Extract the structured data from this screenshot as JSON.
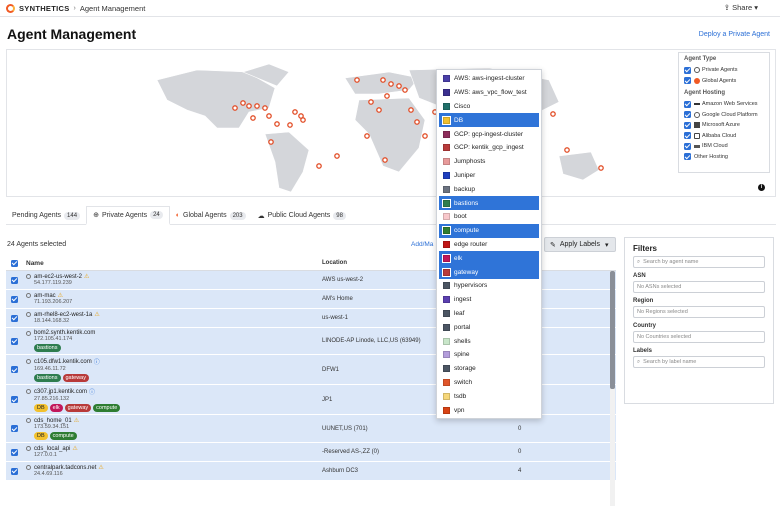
{
  "header": {
    "brand": "SYNTHETICS",
    "breadcrumb": "Agent Management",
    "share_label": "Share"
  },
  "page": {
    "title": "Agent Management",
    "deploy_link": "Deploy a Private Agent"
  },
  "legend": {
    "agent_type_title": "Agent Type",
    "agent_types": [
      {
        "label": "Private Agents",
        "icon": "globe-outline-icon"
      },
      {
        "label": "Global Agents",
        "icon": "kentik-logo-icon"
      }
    ],
    "hosting_title": "Agent Hosting",
    "hosting": [
      {
        "label": "Amazon Web Services",
        "icon": "aws-icon"
      },
      {
        "label": "Google Cloud Platform",
        "icon": "gcp-icon"
      },
      {
        "label": "Microsoft Azure",
        "icon": "azure-icon"
      },
      {
        "label": "Alibaba Cloud",
        "icon": "alibaba-icon"
      },
      {
        "label": "IBM Cloud",
        "icon": "ibm-icon"
      },
      {
        "label": "Other Hosting",
        "icon": ""
      }
    ]
  },
  "tabs": [
    {
      "label": "Pending Agents",
      "count": "144"
    },
    {
      "label": "Private Agents",
      "count": "24"
    },
    {
      "label": "Global Agents",
      "count": "203"
    },
    {
      "label": "Public Cloud Agents",
      "count": "98"
    }
  ],
  "toolbar": {
    "selected_count": "24 Agents selected",
    "add_manage": "Add/Ma",
    "apply_labels": "Apply Labels"
  },
  "table": {
    "headers": {
      "name": "Name",
      "location": "Location"
    },
    "rows": [
      {
        "name": "am-ec2-us-west-2",
        "ip": "54.177.119.239",
        "location": "AWS us-west-2",
        "version": "",
        "warn": true,
        "info": false,
        "tags": []
      },
      {
        "name": "am-mac",
        "ip": "71.193.206.207",
        "location": "AM's Home",
        "version": "",
        "warn": true,
        "info": false,
        "tags": []
      },
      {
        "name": "am-rhel8-ec2-west-1a",
        "ip": "18.144.168.32",
        "location": "us-west-1",
        "version": "",
        "warn": true,
        "info": false,
        "tags": []
      },
      {
        "name": "bom2.synth.kentik.com",
        "ip": "172.105.41.174",
        "location": "LINODE-AP Linode, LLC,US (63949)",
        "version": "",
        "warn": false,
        "info": false,
        "tags": [
          "bastions"
        ]
      },
      {
        "name": "c105.dfw1.kentik.com",
        "ip": "169.46.11.72",
        "location": "DFW1",
        "version": "",
        "warn": false,
        "info": true,
        "tags": [
          "bastions",
          "gateway"
        ]
      },
      {
        "name": "c307.jp1.kentik.com",
        "ip": "27.85.216.132",
        "location": "JP1",
        "version": "",
        "warn": false,
        "info": true,
        "tags": [
          "DB",
          "elk",
          "gateway",
          "compute"
        ]
      },
      {
        "name": "cds_home_01",
        "ip": "173.59.34.151",
        "location": "UUNET,US (701)",
        "version": "0",
        "warn": true,
        "info": false,
        "tags": [
          "DB",
          "compute"
        ]
      },
      {
        "name": "cds_local_api",
        "ip": "127.0.0.1",
        "location": "-Reserved AS-,ZZ (0)",
        "version": "0",
        "warn": true,
        "info": false,
        "tags": []
      },
      {
        "name": "centralpark.tadcons.net",
        "ip": "24.4.69.116",
        "location": "Ashburn DC3",
        "version": "4",
        "warn": true,
        "info": false,
        "tags": []
      }
    ]
  },
  "tag_colors": {
    "bastions": "#2e7d4f",
    "gateway": "#b83a3a",
    "DB": "#f2c12e",
    "elk": "#c2185b",
    "compute": "#2e7d32"
  },
  "filters": {
    "title": "Filters",
    "search_placeholder": "Search by agent name",
    "asn_label": "ASN",
    "asn_value": "No ASNs selected",
    "region_label": "Region",
    "region_value": "No Regions selected",
    "country_label": "Country",
    "country_value": "No Countries selected",
    "labels_label": "Labels",
    "labels_placeholder": "Search by label name"
  },
  "dropdown": {
    "items": [
      {
        "label": "AWS: aws-ingest-cluster",
        "color": "#4a3fa8",
        "selected": false
      },
      {
        "label": "AWS: aws_vpc_flow_test",
        "color": "#3b2f8f",
        "selected": false
      },
      {
        "label": "Cisco",
        "color": "#20706a",
        "selected": false
      },
      {
        "label": "DB",
        "color": "#f2c12e",
        "selected": true
      },
      {
        "label": "GCP: gcp-ingest-cluster",
        "color": "#8e2d5b",
        "selected": false
      },
      {
        "label": "GCP: kentik_gcp_ingest",
        "color": "#b83a3a",
        "selected": false
      },
      {
        "label": "Jumphosts",
        "color": "#e89a9a",
        "selected": false
      },
      {
        "label": "Juniper",
        "color": "#1f3fbf",
        "selected": false
      },
      {
        "label": "backup",
        "color": "#6b7280",
        "selected": false
      },
      {
        "label": "bastions",
        "color": "#2e7d4f",
        "selected": true
      },
      {
        "label": "boot",
        "color": "#f8c8cc",
        "selected": false
      },
      {
        "label": "compute",
        "color": "#2e7d32",
        "selected": true
      },
      {
        "label": "edge router",
        "color": "#c01616",
        "selected": false
      },
      {
        "label": "elk",
        "color": "#c2185b",
        "selected": true
      },
      {
        "label": "gateway",
        "color": "#b83a3a",
        "selected": true
      },
      {
        "label": "hypervisors",
        "color": "#4b5563",
        "selected": false
      },
      {
        "label": "ingest",
        "color": "#5b3fb0",
        "selected": false
      },
      {
        "label": "leaf",
        "color": "#4b5563",
        "selected": false
      },
      {
        "label": "portal",
        "color": "#4b5563",
        "selected": false
      },
      {
        "label": "shells",
        "color": "#c8e6c9",
        "selected": false
      },
      {
        "label": "spine",
        "color": "#b39ddb",
        "selected": false
      },
      {
        "label": "storage",
        "color": "#4b5563",
        "selected": false
      },
      {
        "label": "switch",
        "color": "#e0562a",
        "selected": false
      },
      {
        "label": "tsdb",
        "color": "#f6d77a",
        "selected": false
      },
      {
        "label": "vpn",
        "color": "#d84315",
        "selected": false
      }
    ]
  }
}
